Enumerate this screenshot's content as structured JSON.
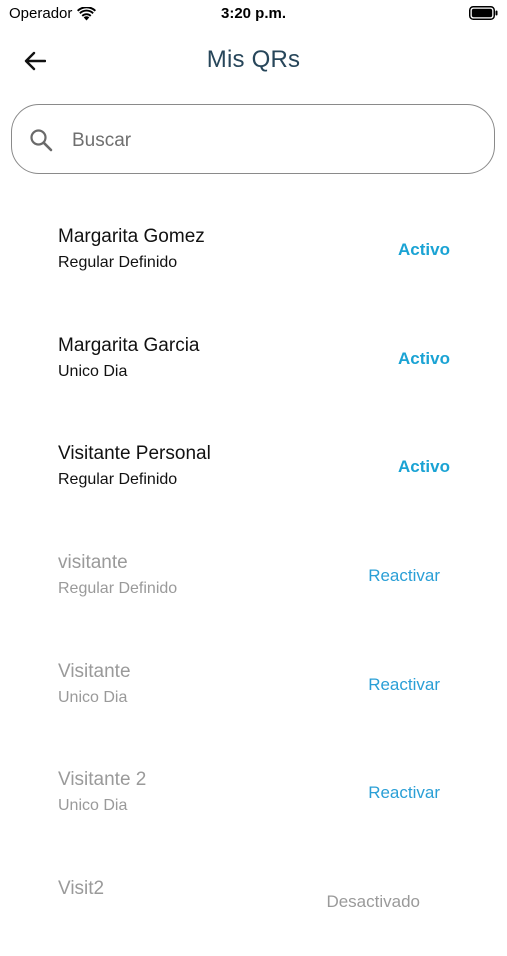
{
  "status_bar": {
    "carrier": "Operador",
    "time": "3:20 p.m."
  },
  "header": {
    "title": "Mis QRs"
  },
  "search": {
    "placeholder": "Buscar",
    "value": ""
  },
  "qr_list": [
    {
      "name": "Margarita Gomez",
      "type": "Regular Definido",
      "action": "Activo",
      "state": "active"
    },
    {
      "name": "Margarita Garcia",
      "type": "Unico Dia",
      "action": "Activo",
      "state": "active"
    },
    {
      "name": "Visitante Personal",
      "type": "Regular Definido",
      "action": "Activo",
      "state": "active"
    },
    {
      "name": "visitante",
      "type": "Regular Definido",
      "action": "Reactivar",
      "state": "reactivate"
    },
    {
      "name": "Visitante",
      "type": "Unico Dia",
      "action": "Reactivar",
      "state": "reactivate"
    },
    {
      "name": "Visitante 2",
      "type": "Unico Dia",
      "action": "Reactivar",
      "state": "reactivate"
    },
    {
      "name": "Visit2",
      "type": "",
      "action": "Desactivado",
      "state": "deactivated"
    }
  ],
  "colors": {
    "title": "#27465a",
    "active": "#1aa3d4",
    "reactivate": "#2a9fd6",
    "inactive_text": "#9a9a9a"
  }
}
